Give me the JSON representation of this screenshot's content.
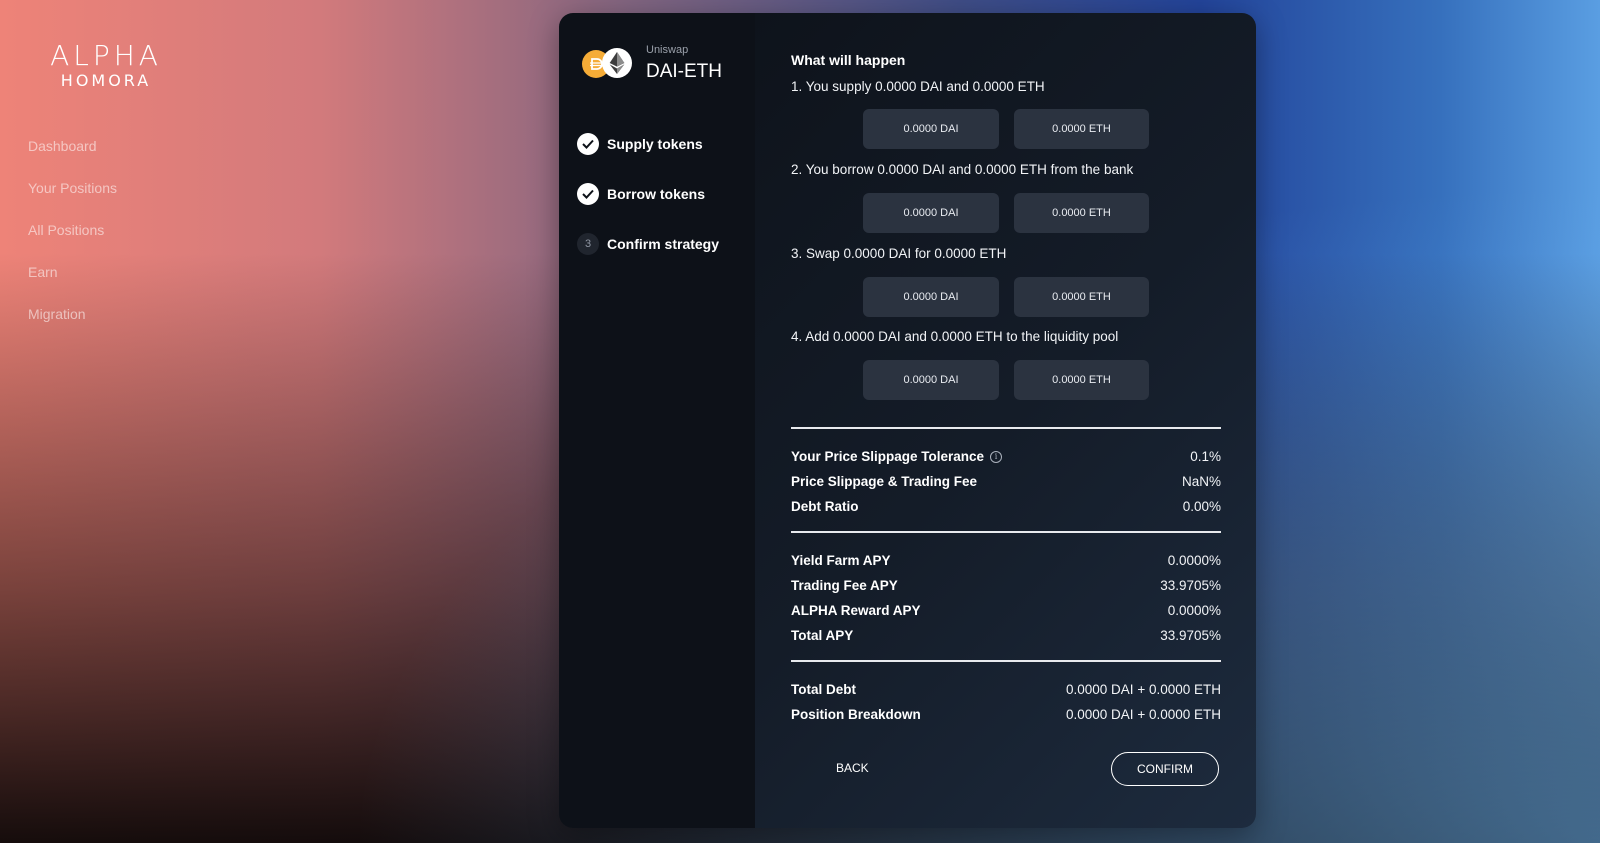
{
  "logo": {
    "top": "ALPHA",
    "bottom": "HOMORA"
  },
  "nav": {
    "items": [
      {
        "label": "Dashboard"
      },
      {
        "label": "Your Positions"
      },
      {
        "label": "All Positions"
      },
      {
        "label": "Earn"
      },
      {
        "label": "Migration"
      }
    ]
  },
  "pool": {
    "dex": "Uniswap",
    "name": "DAI-ETH",
    "tokens": [
      "dai-icon",
      "eth-icon"
    ]
  },
  "steps": [
    {
      "label": "Supply tokens",
      "status": "done"
    },
    {
      "label": "Borrow tokens",
      "status": "done"
    },
    {
      "number": "3",
      "label": "Confirm strategy",
      "status": "current"
    }
  ],
  "summary": {
    "title": "What will happen",
    "actions": [
      {
        "text": "1. You supply 0.0000 DAI and 0.0000 ETH",
        "amounts": [
          "0.0000 DAI",
          "0.0000 ETH"
        ]
      },
      {
        "text": "2. You borrow 0.0000 DAI and 0.0000 ETH from the bank",
        "amounts": [
          "0.0000 DAI",
          "0.0000 ETH"
        ]
      },
      {
        "text": "3. Swap 0.0000 DAI for 0.0000 ETH",
        "amounts": [
          "0.0000 DAI",
          "0.0000 ETH"
        ]
      },
      {
        "text": "4. Add 0.0000 DAI and 0.0000 ETH to the liquidity pool",
        "amounts": [
          "0.0000 DAI",
          "0.0000 ETH"
        ]
      }
    ],
    "risk": [
      {
        "label": "Your Price Slippage Tolerance",
        "value": "0.1%"
      },
      {
        "label": "Price Slippage & Trading Fee",
        "value": "NaN%"
      },
      {
        "label": "Debt Ratio",
        "value": "0.00%"
      }
    ],
    "apy": [
      {
        "label": "Yield Farm APY",
        "value": "0.0000%"
      },
      {
        "label": "Trading Fee APY",
        "value": "33.9705%"
      },
      {
        "label": "ALPHA Reward APY",
        "value": "0.0000%"
      },
      {
        "label": "Total APY",
        "value": "33.9705%"
      }
    ],
    "position": [
      {
        "label": "Total Debt",
        "value": "0.0000 DAI + 0.0000 ETH"
      },
      {
        "label": "Position Breakdown",
        "value": "0.0000 DAI + 0.0000 ETH"
      }
    ]
  },
  "buttons": {
    "back": "BACK",
    "confirm": "CONFIRM"
  },
  "colors": {
    "dai": "#f5ac37",
    "panel_dark": "#0d1118",
    "amount_box": "#2b3340"
  }
}
